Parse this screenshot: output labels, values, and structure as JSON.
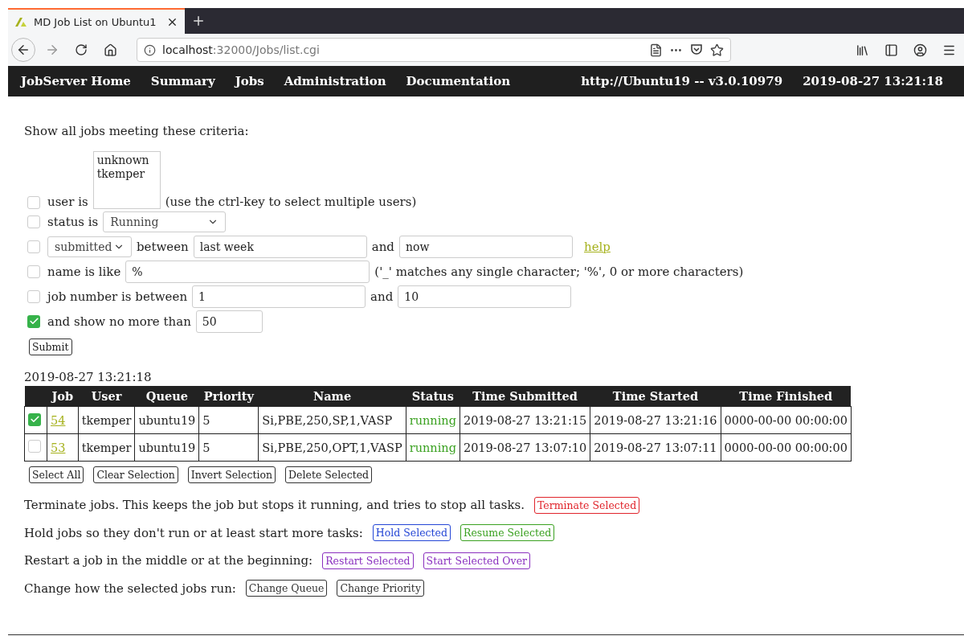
{
  "browser": {
    "tab_title": "MD Job List on Ubuntu1",
    "url_host": "localhost",
    "url_path": ":32000/Jobs/list.cgi"
  },
  "nav": {
    "items": [
      "JobServer Home",
      "Summary",
      "Jobs",
      "Administration",
      "Documentation"
    ],
    "server_info": "http://Ubuntu19 -- v3.0.10979",
    "timestamp": "2019-08-27 13:21:18"
  },
  "criteria": {
    "heading": "Show all jobs meeting these criteria:",
    "filters": [
      {
        "kind": "users",
        "checked": false,
        "label": "user is",
        "options": [
          "unknown",
          "tkemper"
        ],
        "note": "(use the ctrl-key to select multiple users)"
      },
      {
        "kind": "select",
        "checked": false,
        "label": "status is",
        "value": "Running"
      },
      {
        "kind": "dates",
        "checked": false,
        "field": "submitted",
        "label": "between",
        "from": "last week",
        "joiner": "and",
        "to": "now",
        "link": "help"
      },
      {
        "kind": "text",
        "checked": false,
        "label": "name is like",
        "value": "%",
        "note": "('_' matches any single character; '%', 0 or more characters)"
      },
      {
        "kind": "range",
        "checked": false,
        "label": "job number is between",
        "from": "1",
        "joiner": "and",
        "to": "10"
      },
      {
        "kind": "limit",
        "checked": true,
        "label": "and show no more than",
        "value": "50"
      }
    ],
    "submit": "Submit"
  },
  "results": {
    "timestamp": "2019-08-27 13:21:18",
    "columns": [
      "Job",
      "User",
      "Queue",
      "Priority",
      "Name",
      "Status",
      "Time Submitted",
      "Time Started",
      "Time Finished"
    ],
    "rows": [
      {
        "checked": true,
        "job": "54",
        "user": "tkemper",
        "queue": "ubuntu19",
        "priority": "5",
        "name": "Si,PBE,250,SP,1,VASP",
        "status": "running",
        "submitted": "2019-08-27 13:21:15",
        "started": "2019-08-27 13:21:16",
        "finished": "0000-00-00 00:00:00"
      },
      {
        "checked": false,
        "job": "53",
        "user": "tkemper",
        "queue": "ubuntu19",
        "priority": "5",
        "name": "Si,PBE,250,OPT,1,VASP",
        "status": "running",
        "submitted": "2019-08-27 13:07:10",
        "started": "2019-08-27 13:07:11",
        "finished": "0000-00-00 00:00:00"
      }
    ],
    "selection_buttons": [
      "Select All",
      "Clear Selection",
      "Invert Selection",
      "Delete Selected"
    ]
  },
  "actions": [
    {
      "text": "Terminate jobs. This keeps the job but stops it running, and tries to stop all tasks.",
      "buttons": [
        {
          "label": "Terminate Selected",
          "color": "#e0242b"
        }
      ]
    },
    {
      "text": "Hold jobs so they don't run or at least start more tasks:",
      "buttons": [
        {
          "label": "Hold Selected",
          "color": "#2446d6"
        },
        {
          "label": "Resume Selected",
          "color": "#3aa120"
        }
      ]
    },
    {
      "text": "Restart a job in the middle or at the beginning:",
      "buttons": [
        {
          "label": "Restart Selected",
          "color": "#8a2fbf"
        },
        {
          "label": "Start Selected Over",
          "color": "#8a2fbf"
        }
      ]
    },
    {
      "text": "Change how the selected jobs run:",
      "buttons": [
        {
          "label": "Change Queue",
          "color": "#333333"
        },
        {
          "label": "Change Priority",
          "color": "#333333"
        }
      ]
    }
  ]
}
